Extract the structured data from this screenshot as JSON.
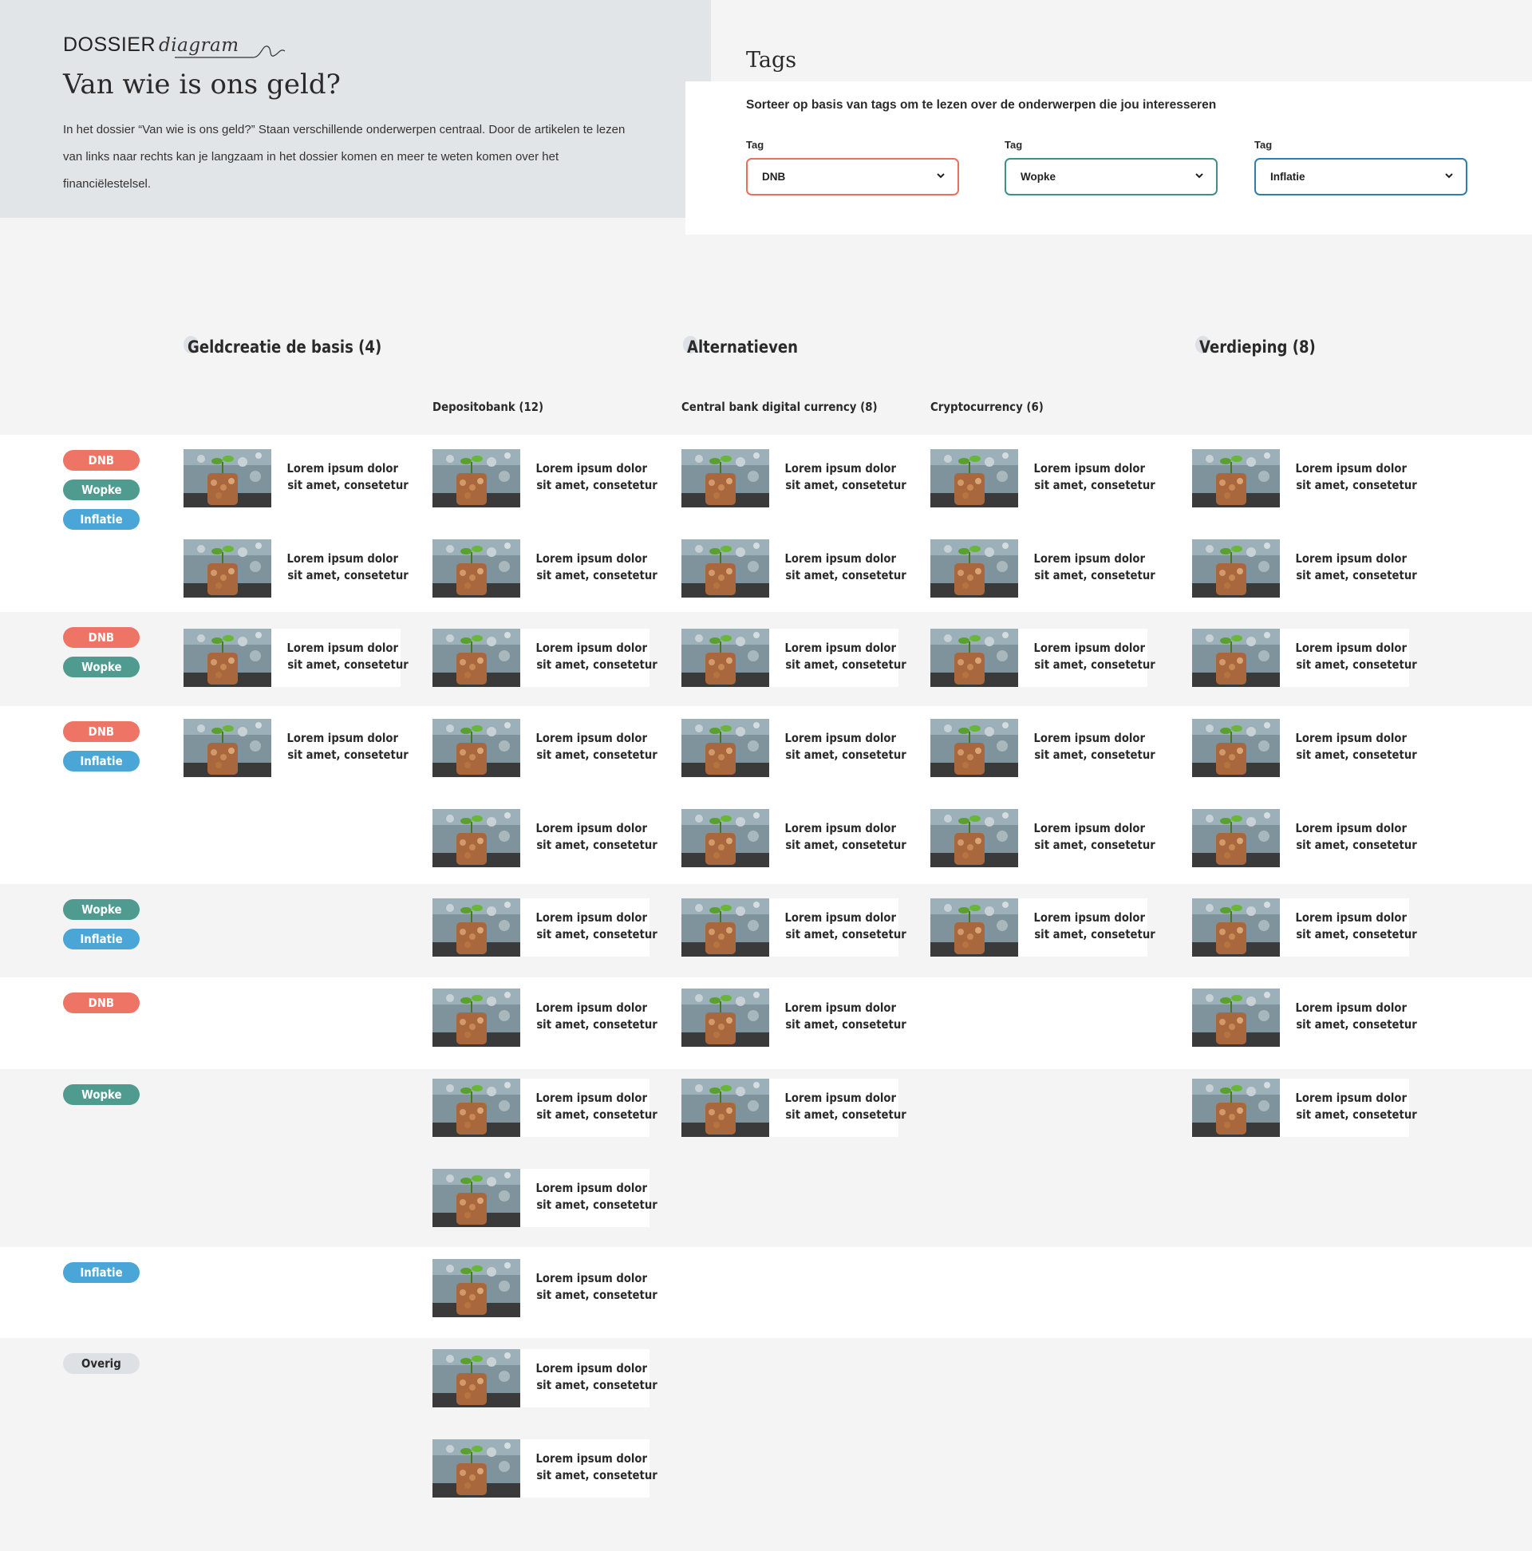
{
  "header": {
    "kicker": "DOSSIER",
    "kicker_script": "diagram",
    "title": "Van wie is ons geld?",
    "intro": "In het dossier “Van wie is ons geld?” Staan verschillende onderwerpen centraal. Door de artikelen te lezen van links naar rechts kan je langzaam in het dossier komen en meer te weten komen over het financiëlestelsel."
  },
  "tags_panel": {
    "title": "Tags",
    "subtitle": "Sorteer op basis van tags om te lezen over de onderwerpen die jou interesseren",
    "selects": [
      {
        "label": "Tag",
        "value": "DNB",
        "border_color": "#e8705f"
      },
      {
        "label": "Tag",
        "value": "Wopke",
        "border_color": "#3f8f8a"
      },
      {
        "label": "Tag",
        "value": "Inflatie",
        "border_color": "#2e7fae"
      }
    ]
  },
  "groups": [
    {
      "label": "Geldcreatie de basis (4)"
    },
    {
      "label": "Alternatieven"
    },
    {
      "label": "Verdieping (8)"
    }
  ],
  "subcolumns": [
    {
      "label": "Depositobank (12)"
    },
    {
      "label": "Central bank digital currency (8)"
    },
    {
      "label": "Cryptocurrency (6)"
    }
  ],
  "tag_colors": {
    "DNB": "#ee7565",
    "Wopke": "#4f9b8f",
    "Inflatie": "#4aa6d6",
    "Overig": "#dde1e5"
  },
  "card_text": {
    "line1": "Lorem ipsum dolor",
    "line2": "sit amet, consetetur"
  },
  "rows": [
    {
      "tags": [
        "DNB",
        "Wopke",
        "Inflatie"
      ],
      "counts": [
        2,
        2,
        2,
        2,
        2
      ]
    },
    {
      "tags": [
        "DNB",
        "Wopke"
      ],
      "counts": [
        1,
        1,
        1,
        1,
        1
      ]
    },
    {
      "tags": [
        "DNB",
        "Inflatie"
      ],
      "counts": [
        1,
        2,
        2,
        2,
        2
      ]
    },
    {
      "tags": [
        "Wopke",
        "Inflatie"
      ],
      "counts": [
        0,
        1,
        1,
        1,
        1
      ]
    },
    {
      "tags": [
        "DNB"
      ],
      "counts": [
        0,
        1,
        1,
        0,
        1
      ]
    },
    {
      "tags": [
        "Wopke"
      ],
      "counts": [
        0,
        2,
        1,
        0,
        1
      ]
    },
    {
      "tags": [
        "Inflatie"
      ],
      "counts": [
        0,
        1,
        0,
        0,
        0
      ]
    },
    {
      "tags": [
        "Overig"
      ],
      "counts": [
        0,
        2,
        0,
        0,
        0
      ]
    }
  ]
}
